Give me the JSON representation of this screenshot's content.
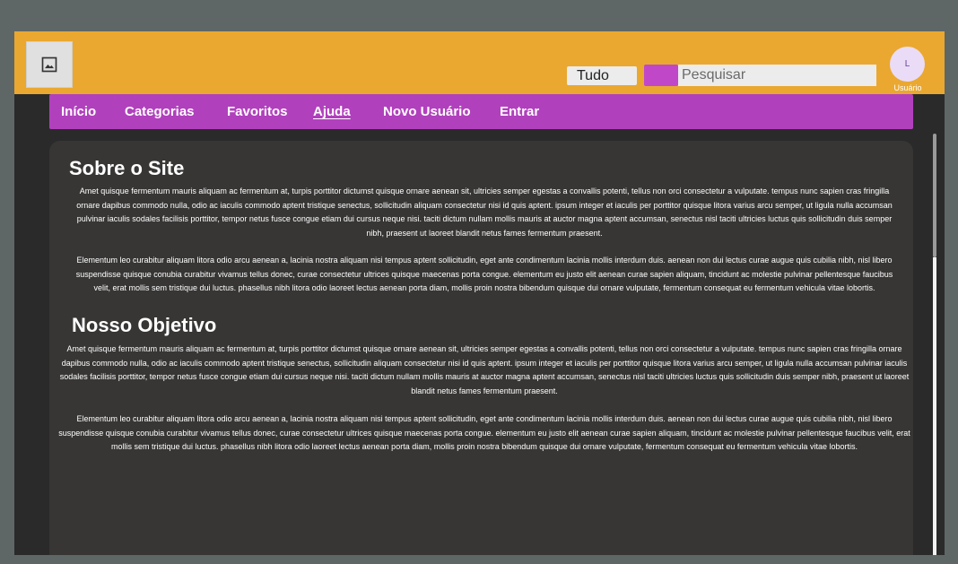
{
  "header": {
    "logo_icon": "image-icon",
    "category_select": "Tudo",
    "search_placeholder": "Pesquisar",
    "avatar_initial": "L",
    "user_label": "Usuário"
  },
  "nav": {
    "items": [
      {
        "label": "Início"
      },
      {
        "label": "Categorias"
      },
      {
        "label": "Favoritos"
      },
      {
        "label": "Ajuda",
        "active": true
      },
      {
        "label": "Novo Usuário"
      },
      {
        "label": "Entrar"
      }
    ]
  },
  "content": {
    "section1_title": "Sobre o Site",
    "section1_p1": "Amet quisque fermentum mauris aliquam ac fermentum at, turpis porttitor dictumst quisque ornare aenean sit, ultricies semper egestas a convallis potenti, tellus non orci consectetur a vulputate. tempus nunc sapien cras fringilla ornare dapibus commodo nulla, odio ac iaculis commodo aptent tristique senectus, sollicitudin aliquam consectetur nisi id quis aptent. ipsum integer et iaculis per porttitor quisque litora varius arcu semper, ut ligula nulla accumsan pulvinar iaculis sodales facilisis porttitor, tempor netus fusce congue etiam dui cursus neque nisi. taciti dictum nullam mollis mauris at auctor magna aptent accumsan, senectus nisl taciti ultricies luctus quis sollicitudin duis semper nibh, praesent ut laoreet blandit netus fames fermentum praesent.",
    "section1_p2": "Elementum leo curabitur aliquam litora odio arcu aenean a, lacinia nostra aliquam nisi tempus aptent sollicitudin, eget ante condimentum lacinia mollis interdum duis. aenean non dui lectus curae augue quis cubilia nibh, nisl libero suspendisse quisque conubia curabitur vivamus tellus donec, curae consectetur ultrices quisque maecenas porta congue. elementum eu justo elit aenean curae sapien aliquam, tincidunt ac molestie pulvinar pellentesque faucibus velit, erat mollis sem tristique dui luctus. phasellus nibh litora odio laoreet lectus aenean porta diam, mollis proin nostra bibendum quisque dui ornare vulputate, fermentum consequat eu fermentum vehicula vitae lobortis.",
    "section2_title": "Nosso Objetivo",
    "section2_p1": "Amet quisque fermentum mauris aliquam ac fermentum at, turpis porttitor dictumst quisque ornare aenean sit, ultricies semper egestas a convallis potenti, tellus non orci consectetur a vulputate. tempus nunc sapien cras fringilla ornare dapibus commodo nulla, odio ac iaculis commodo aptent tristique senectus, sollicitudin aliquam consectetur nisi id quis aptent. ipsum integer et iaculis per porttitor quisque litora varius arcu semper, ut ligula nulla accumsan pulvinar iaculis sodales facilisis porttitor, tempor netus fusce congue etiam dui cursus neque nisi. taciti dictum nullam mollis mauris at auctor magna aptent accumsan, senectus nisl taciti ultricies luctus quis sollicitudin duis semper nibh, praesent ut laoreet blandit netus fames fermentum praesent.",
    "section2_p2": "Elementum leo curabitur aliquam litora odio arcu aenean a, lacinia nostra aliquam nisi tempus aptent sollicitudin, eget ante condimentum lacinia mollis interdum duis. aenean non dui lectus curae augue quis cubilia nibh, nisl libero suspendisse quisque conubia curabitur vivamus tellus donec, curae consectetur ultrices quisque maecenas porta congue. elementum eu justo elit aenean curae sapien aliquam, tincidunt ac molestie pulvinar pellentesque faucibus velit, erat mollis sem tristique dui luctus. phasellus nibh litora odio laoreet lectus aenean porta diam, mollis proin nostra bibendum quisque dui ornare vulputate, fermentum consequat eu fermentum vehicula vitae lobortis."
  },
  "colors": {
    "header_bg": "#eaa830",
    "nav_bg": "#b140bd",
    "search_button": "#c048c8",
    "content_bg": "#373635",
    "page_bg": "#2a2a2a"
  }
}
